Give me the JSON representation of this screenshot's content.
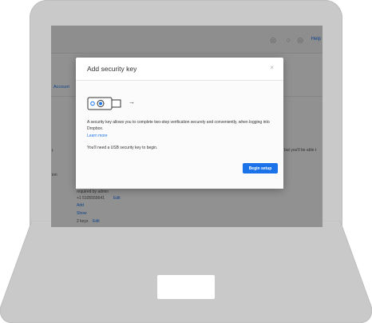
{
  "topbar": {
    "help_label": "Help"
  },
  "nav": {
    "account_tab": "Account"
  },
  "background": {
    "left_fragment_1": "t",
    "left_fragment_2": "ion",
    "right_fragment": "but you'll be able t",
    "row_1": "required by admin",
    "row_2_number": "+1 5105555641",
    "row_2_edit": "Edit",
    "row_3_add": "Add",
    "row_4_show": "Show",
    "row_5_keys": "2 keys",
    "row_5_edit": "Edit"
  },
  "modal": {
    "title": "Add security key",
    "close_glyph": "×",
    "arrow_glyph": "→",
    "description": "A security key allows you to complete two-step verification securely and conveniently, when logging into Dropbox.",
    "learn_more": "Learn more",
    "usb_note": "You'll need a USB security key to begin.",
    "begin_button": "Begin setup"
  },
  "colors": {
    "accent": "#1a73e8",
    "overlay": "rgba(0,0,0,0.42)",
    "laptop": "#c9c9c9"
  }
}
